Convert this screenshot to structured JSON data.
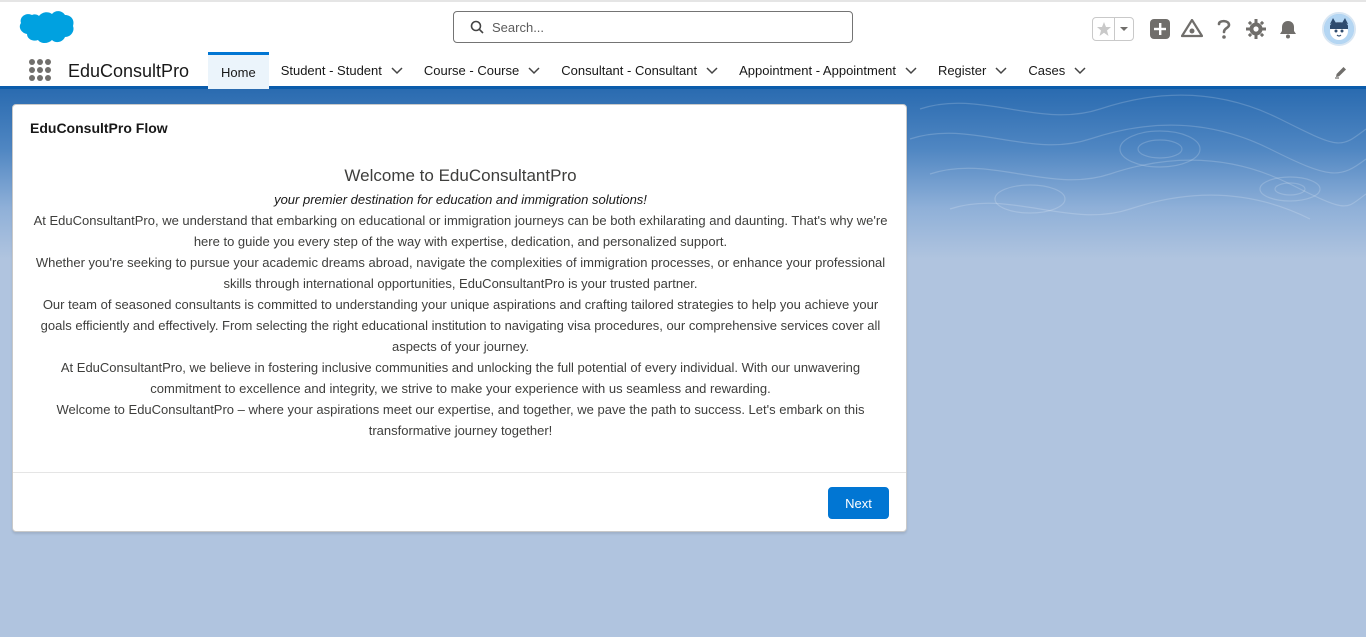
{
  "header": {
    "search_placeholder": "Search...",
    "icons": [
      "salesforce-cloud-logo",
      "search-icon",
      "favorite-star-icon",
      "chevron-down-icon",
      "global-actions-plus-icon",
      "trailhead-guidance-icon",
      "help-icon",
      "setup-gear-icon",
      "notifications-bell-icon",
      "user-avatar"
    ]
  },
  "nav": {
    "app_name": "EduConsultPro",
    "items": [
      {
        "label": "Home",
        "active": true,
        "has_menu": false
      },
      {
        "label": "Student - Student",
        "active": false,
        "has_menu": true
      },
      {
        "label": "Course - Course",
        "active": false,
        "has_menu": true
      },
      {
        "label": "Consultant - Consultant",
        "active": false,
        "has_menu": true
      },
      {
        "label": "Appointment - Appointment",
        "active": false,
        "has_menu": true
      },
      {
        "label": "Register",
        "active": false,
        "has_menu": true
      },
      {
        "label": "Cases",
        "active": false,
        "has_menu": true
      }
    ]
  },
  "flow": {
    "title": "EduConsultPro Flow",
    "heading": "Welcome to EduConsultantPro",
    "tagline": "your premier destination for education and immigration solutions!",
    "paragraphs": [
      "At EduConsultantPro, we understand that embarking on educational or immigration journeys can be both exhilarating and daunting. That's why we're here to guide you every step of the way with expertise, dedication, and personalized support.",
      "Whether you're seeking to pursue your academic dreams abroad, navigate the complexities of immigration processes, or enhance your professional skills through international opportunities, EduConsultantPro is your trusted partner.",
      "Our team of seasoned consultants is committed to understanding your unique aspirations and crafting tailored strategies to help you achieve your goals efficiently and effectively. From selecting the right educational institution to navigating visa procedures, our comprehensive services cover all aspects of your journey.",
      "At EduConsultantPro, we believe in fostering inclusive communities and unlocking the full potential of every individual. With our unwavering commitment to excellence and integrity, we strive to make your experience with us seamless and rewarding.",
      "Welcome to EduConsultantPro – where your aspirations meet our expertise, and together, we pave the path to success. Let's embark on this transformative journey together!"
    ],
    "next_label": "Next"
  },
  "colors": {
    "brand_blue": "#0176d3",
    "nav_underline": "#0b5cab",
    "page_background": "#b0c4df"
  }
}
